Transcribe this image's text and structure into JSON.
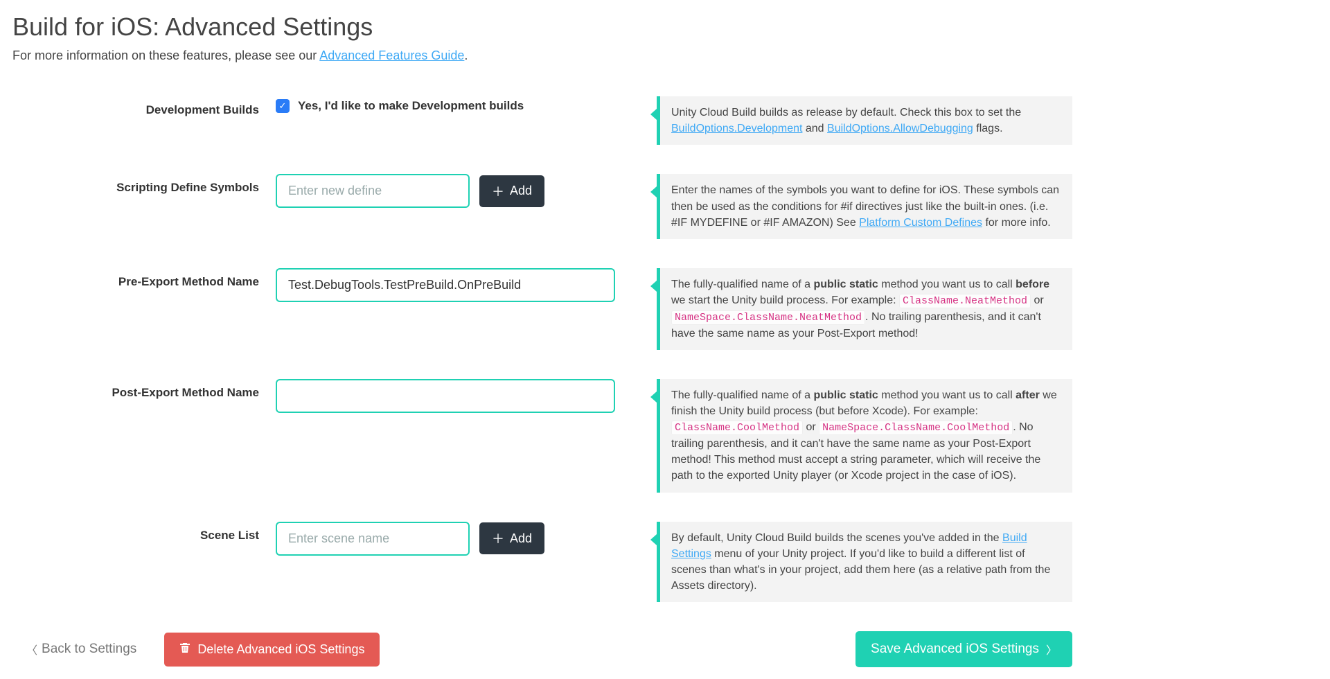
{
  "header": {
    "title": "Build for iOS: Advanced Settings",
    "sub_pre": "For more information on these features, please see our ",
    "sub_link": "Advanced Features Guide",
    "sub_post": "."
  },
  "rows": {
    "dev": {
      "label": "Development Builds",
      "checkbox_label": "Yes, I'd like to make Development builds",
      "help_pre": "Unity Cloud Build builds as release by default. Check this box to set the ",
      "help_link1": "BuildOptions.Development",
      "help_mid": " and ",
      "help_link2": "BuildOptions.AllowDebugging",
      "help_post": " flags."
    },
    "symbols": {
      "label": "Scripting Define Symbols",
      "placeholder": "Enter new define",
      "add_label": "Add",
      "help_pre": "Enter the names of the symbols you want to define for iOS. These symbols can then be used as the conditions for #if directives just like the built-in ones. (i.e. #IF MYDEFINE or #IF AMAZON) See ",
      "help_link": "Platform Custom Defines",
      "help_post": " for more info."
    },
    "pre": {
      "label": "Pre-Export Method Name",
      "value": "Test.DebugTools.TestPreBuild.OnPreBuild",
      "help_a": "The fully-qualified name of a ",
      "help_public_static": "public static",
      "help_b": " method you want us to call ",
      "help_before": "before",
      "help_c": " we start the Unity build process. For example: ",
      "code1": "ClassName.NeatMethod",
      "help_or": " or ",
      "code2": "NameSpace.ClassName.NeatMethod",
      "help_d": ". No trailing parenthesis, and it can't have the same name as your Post-Export method!"
    },
    "post": {
      "label": "Post-Export Method Name",
      "value": "",
      "help_a": "The fully-qualified name of a ",
      "help_public_static": "public static",
      "help_b": " method you want us to call ",
      "help_after": "after",
      "help_c": " we finish the Unity build process (but before Xcode). For example: ",
      "code1": "ClassName.CoolMethod",
      "help_or": " or ",
      "code2": "NameSpace.ClassName.CoolMethod",
      "help_d": ". No trailing parenthesis, and it can't have the same name as your Post-Export method! This method must accept a string parameter, which will receive the path to the exported Unity player (or Xcode project in the case of iOS)."
    },
    "scene": {
      "label": "Scene List",
      "placeholder": "Enter scene name",
      "add_label": "Add",
      "help_a": "By default, Unity Cloud Build builds the scenes you've added in the ",
      "help_link": "Build Settings",
      "help_b": " menu of your Unity project. If you'd like to build a different list of scenes than what's in your project, add them here (as a relative path from the Assets directory)."
    }
  },
  "footer": {
    "back": "Back to Settings",
    "delete": "Delete Advanced iOS Settings",
    "save": "Save Advanced iOS Settings"
  }
}
